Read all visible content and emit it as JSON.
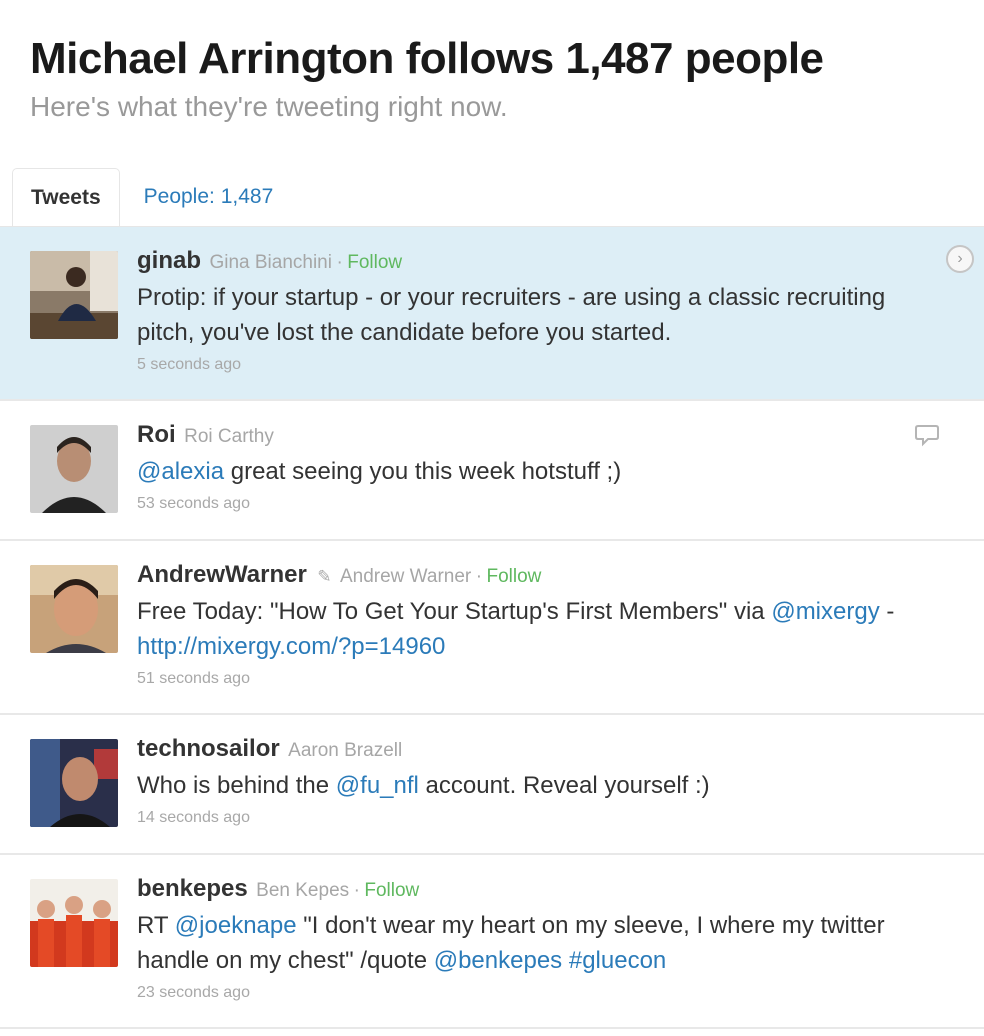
{
  "header": {
    "title": "Michael Arrington follows 1,487 people",
    "subtitle": "Here's what they're tweeting right now."
  },
  "tabs": {
    "tweets": "Tweets",
    "people": "People: 1,487"
  },
  "colors": {
    "link": "#2b7bb9",
    "follow": "#5fb85f",
    "highlight_row": "#ddeef6"
  },
  "icons": {
    "row1_action": "chevron-right-icon",
    "row2_action": "reply-bubble-icon",
    "row3_name_marker": "pencil-icon"
  },
  "tweets": [
    {
      "screen_name": "ginab",
      "full_name": "Gina Bianchini",
      "follow": "Follow",
      "text_1": "Protip: if your startup - or your recruiters - are using a classic recruiting pitch, you've lost the candidate before you started.",
      "time": "5 seconds ago"
    },
    {
      "screen_name": "Roi",
      "full_name": "Roi Carthy",
      "mention_1": "@alexia",
      "text_1": " great seeing you this week hotstuff ;)",
      "time": "53 seconds ago"
    },
    {
      "screen_name": "AndrewWarner",
      "full_name": "Andrew Warner",
      "follow": "Follow",
      "text_1": "Free Today: \"How To Get Your Startup's First Members\" via ",
      "mention_1": "@mixergy",
      "text_2": " - ",
      "url": "http://mixergy.com/?p=14960",
      "time": "51 seconds ago"
    },
    {
      "screen_name": "technosailor",
      "full_name": "Aaron Brazell",
      "text_1": "Who is behind the ",
      "mention_1": "@fu_nfl",
      "text_2": " account. Reveal yourself :)",
      "time": "14 seconds ago"
    },
    {
      "screen_name": "benkepes",
      "full_name": "Ben Kepes",
      "follow": "Follow",
      "text_1": "RT ",
      "mention_1": "@joeknape",
      "text_2": " \"I don't wear my heart on my sleeve, I where my twitter handle on my chest\" /quote ",
      "mention_2": "@benkepes",
      "text_3": " ",
      "hashtag": "#gluecon",
      "time": "23 seconds ago"
    }
  ]
}
